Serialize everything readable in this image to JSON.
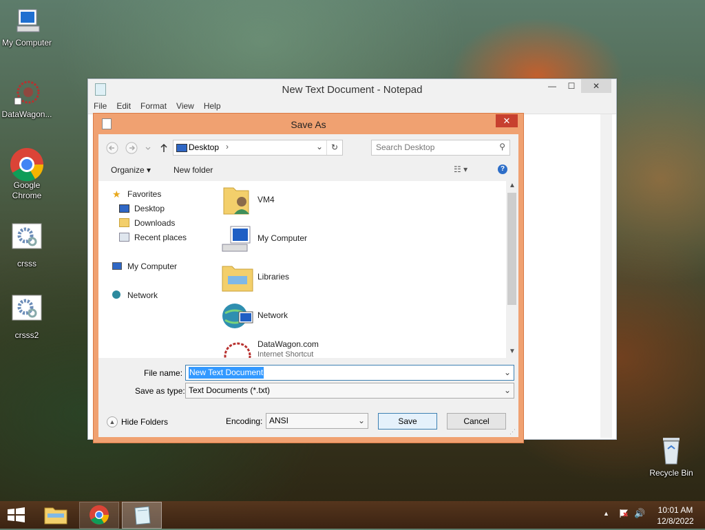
{
  "desktop": {
    "icons": [
      {
        "label": "My Computer"
      },
      {
        "label": "DataWagon..."
      },
      {
        "label": "Google Chrome"
      },
      {
        "label": "crsss"
      },
      {
        "label": "crsss2"
      },
      {
        "label": "Recycle Bin"
      }
    ]
  },
  "notepad": {
    "title": "New Text Document - Notepad",
    "menu": [
      "File",
      "Edit",
      "Format",
      "View",
      "Help"
    ],
    "minimize_glyph": "—",
    "maximize_glyph": "☐",
    "close_glyph": "✕"
  },
  "dialog": {
    "title": "Save As",
    "close_glyph": "✕",
    "address": {
      "location": "Desktop",
      "separator": "›"
    },
    "search": {
      "placeholder": "Search Desktop"
    },
    "toolbar": {
      "organize": "Organize ▾",
      "new_folder": "New folder",
      "help": "?"
    },
    "nav": {
      "favorites": "Favorites",
      "desktop": "Desktop",
      "downloads": "Downloads",
      "recent": "Recent places",
      "my_computer": "My Computer",
      "network": "Network"
    },
    "files": [
      {
        "name": "VM4",
        "sub": ""
      },
      {
        "name": "My Computer",
        "sub": ""
      },
      {
        "name": "Libraries",
        "sub": ""
      },
      {
        "name": "Network",
        "sub": ""
      },
      {
        "name": "DataWagon.com",
        "sub": "Internet Shortcut"
      }
    ],
    "file_name_label": "File name:",
    "file_name_value": "New Text Document",
    "save_type_label": "Save as type:",
    "save_type_value": "Text Documents (*.txt)",
    "hide_folders": "Hide Folders",
    "encoding_label": "Encoding:",
    "encoding_value": "ANSI",
    "save_button": "Save",
    "cancel_button": "Cancel"
  },
  "taskbar": {
    "clock_time": "10:01 AM",
    "clock_date": "12/8/2022"
  },
  "colors": {
    "dialog_frame": "#f0a171",
    "selection": "#3399ff",
    "close_red": "#c7402f"
  }
}
